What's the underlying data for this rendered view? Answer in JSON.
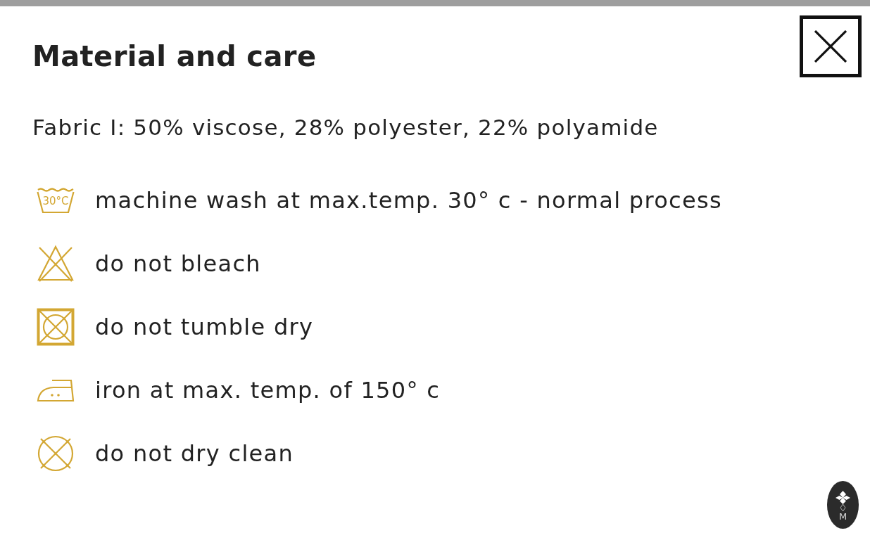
{
  "title": "Material and care",
  "composition": "Fabric I: 50% viscose, 28% polyester, 22% polyamide",
  "care_instructions": [
    {
      "kind": "wash",
      "temperature": "30°C",
      "text": "machine wash at max.temp. 30° c - normal process"
    },
    {
      "kind": "no-bleach",
      "text": "do not bleach"
    },
    {
      "kind": "no-tumble-dry",
      "text": "do not tumble dry"
    },
    {
      "kind": "iron",
      "text": "iron at max. temp. of 150° c"
    },
    {
      "kind": "no-dry-clean",
      "text": "do not dry clean"
    }
  ],
  "badge": {
    "monogram": "M"
  }
}
